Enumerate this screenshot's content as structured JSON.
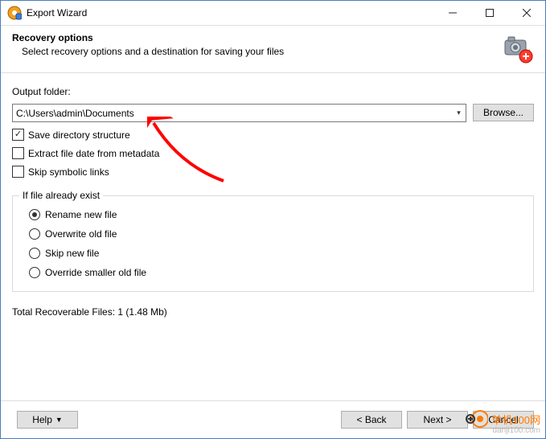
{
  "window": {
    "title": "Export Wizard"
  },
  "header": {
    "title": "Recovery options",
    "subtitle": "Select recovery options and a destination for saving your files"
  },
  "output": {
    "label": "Output folder:",
    "value": "C:\\Users\\admin\\Documents",
    "browse": "Browse..."
  },
  "checks": {
    "save_dir": {
      "label": "Save directory structure",
      "checked": true
    },
    "extract_date": {
      "label": "Extract file date from metadata",
      "checked": false
    },
    "skip_symlink": {
      "label": "Skip symbolic links",
      "checked": false
    }
  },
  "group": {
    "legend": "If file already exist",
    "options": [
      {
        "label": "Rename new file",
        "selected": true
      },
      {
        "label": "Overwrite old file",
        "selected": false
      },
      {
        "label": "Skip new file",
        "selected": false
      },
      {
        "label": "Override smaller old file",
        "selected": false
      }
    ]
  },
  "total": "Total Recoverable Files: 1 (1.48 Mb)",
  "footer": {
    "help": "Help",
    "back": "< Back",
    "next": "Next >",
    "cancel": "Cancel"
  },
  "watermark": {
    "line1": "单机100网",
    "line2": "danji100.com"
  }
}
